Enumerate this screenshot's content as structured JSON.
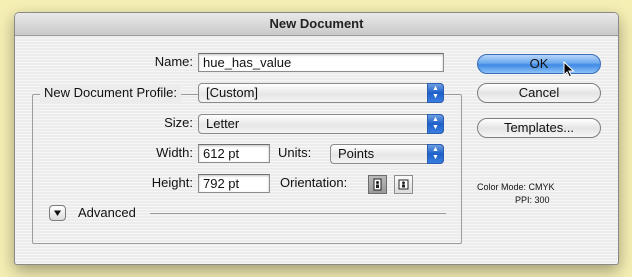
{
  "window": {
    "title": "New Document"
  },
  "name": {
    "label": "Name:",
    "value": "hue_has_value"
  },
  "profile": {
    "label": "New Document Profile:",
    "value": "[Custom]"
  },
  "size": {
    "label": "Size:",
    "value": "Letter"
  },
  "width": {
    "label": "Width:",
    "value": "612 pt"
  },
  "units": {
    "label": "Units:",
    "value": "Points"
  },
  "height": {
    "label": "Height:",
    "value": "792 pt"
  },
  "orientation": {
    "label": "Orientation:",
    "selected": "portrait"
  },
  "advanced": {
    "label": "Advanced",
    "expanded": false
  },
  "buttons": {
    "ok": "OK",
    "cancel": "Cancel",
    "templates": "Templates..."
  },
  "info": {
    "color_mode": "Color Mode: CMYK",
    "ppi": "PPI: 300"
  }
}
